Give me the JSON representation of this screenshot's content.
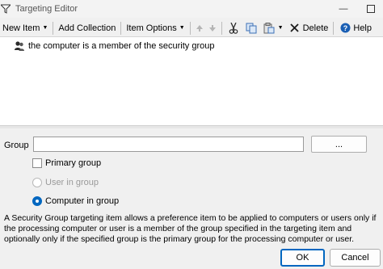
{
  "window": {
    "title": "Targeting Editor"
  },
  "toolbar": {
    "new_item": "New Item",
    "add_collection": "Add Collection",
    "item_options": "Item Options",
    "delete": "Delete",
    "help": "Help"
  },
  "items": [
    {
      "label": "the computer is a member of the security group",
      "icon": "security-group-icon"
    }
  ],
  "properties": {
    "group_label": "Group",
    "group_value": "",
    "browse_label": "...",
    "primary_group": {
      "label": "Primary group",
      "checked": false
    },
    "user_in_group": {
      "label": "User in group",
      "selected": false,
      "enabled": false
    },
    "computer_in_group": {
      "label": "Computer in group",
      "selected": true
    },
    "description": "A Security Group targeting item allows a preference item to be applied to computers or users only if the processing computer or user is a member of the group specified in the targeting item and optionally only if the specified group is the primary group for the processing computer or user."
  },
  "footer": {
    "ok": "OK",
    "cancel": "Cancel"
  },
  "colors": {
    "accent": "#0067c0",
    "help_blue": "#1a5fb4"
  }
}
